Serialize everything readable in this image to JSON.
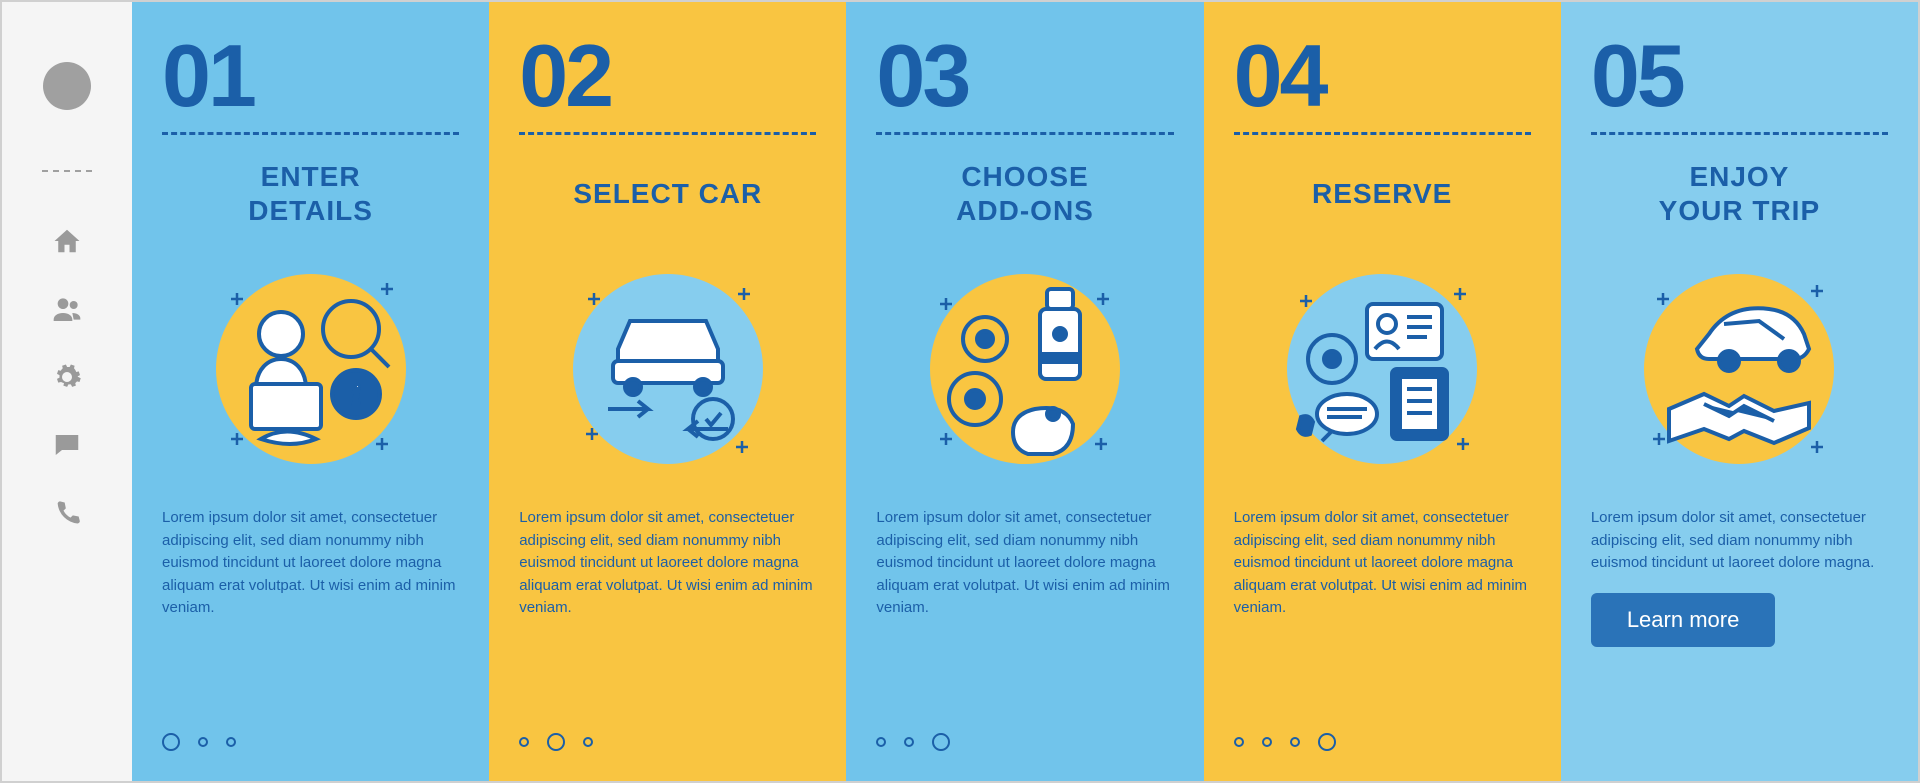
{
  "colors": {
    "primary": "#1b5fa8",
    "panel_blue_light": "#86cdee",
    "panel_blue_dark": "#71c4eb",
    "panel_yellow": "#f9c541",
    "cta_bg": "#2a73b8"
  },
  "sidebar": {
    "icons": [
      {
        "name": "home-icon"
      },
      {
        "name": "users-icon"
      },
      {
        "name": "gear-icon"
      },
      {
        "name": "chat-icon"
      },
      {
        "name": "phone-icon"
      }
    ]
  },
  "steps": [
    {
      "num": "01",
      "title": "ENTER\nDETAILS",
      "icon": "user-search-icon",
      "desc": "Lorem ipsum dolor sit amet, consectetuer adipiscing elit, sed diam nonummy nibh euismod tincidunt ut laoreet dolore magna aliquam erat volutpat. Ut wisi enim ad minim veniam."
    },
    {
      "num": "02",
      "title": "SELECT CAR",
      "icon": "car-select-icon",
      "desc": "Lorem ipsum dolor sit amet, consectetuer adipiscing elit, sed diam nonummy nibh euismod tincidunt ut laoreet dolore magna aliquam erat volutpat. Ut wisi enim ad minim veniam."
    },
    {
      "num": "03",
      "title": "CHOOSE\nADD-ONS",
      "icon": "addons-icon",
      "desc": "Lorem ipsum dolor sit amet, consectetuer adipiscing elit, sed diam nonummy nibh euismod tincidunt ut laoreet dolore magna aliquam erat volutpat. Ut wisi enim ad minim veniam."
    },
    {
      "num": "04",
      "title": "RESERVE",
      "icon": "reserve-icon",
      "desc": "Lorem ipsum dolor sit amet, consectetuer adipiscing elit, sed diam nonummy nibh euismod tincidunt ut laoreet dolore magna aliquam erat volutpat. Ut wisi enim ad minim veniam."
    },
    {
      "num": "05",
      "title": "ENJOY\nYOUR TRIP",
      "icon": "handshake-car-icon",
      "desc": "Lorem ipsum dolor sit amet, consectetuer adipiscing elit, sed diam nonummy nibh euismod tincidunt ut laoreet dolore magna."
    }
  ],
  "cta_label": "Learn more"
}
